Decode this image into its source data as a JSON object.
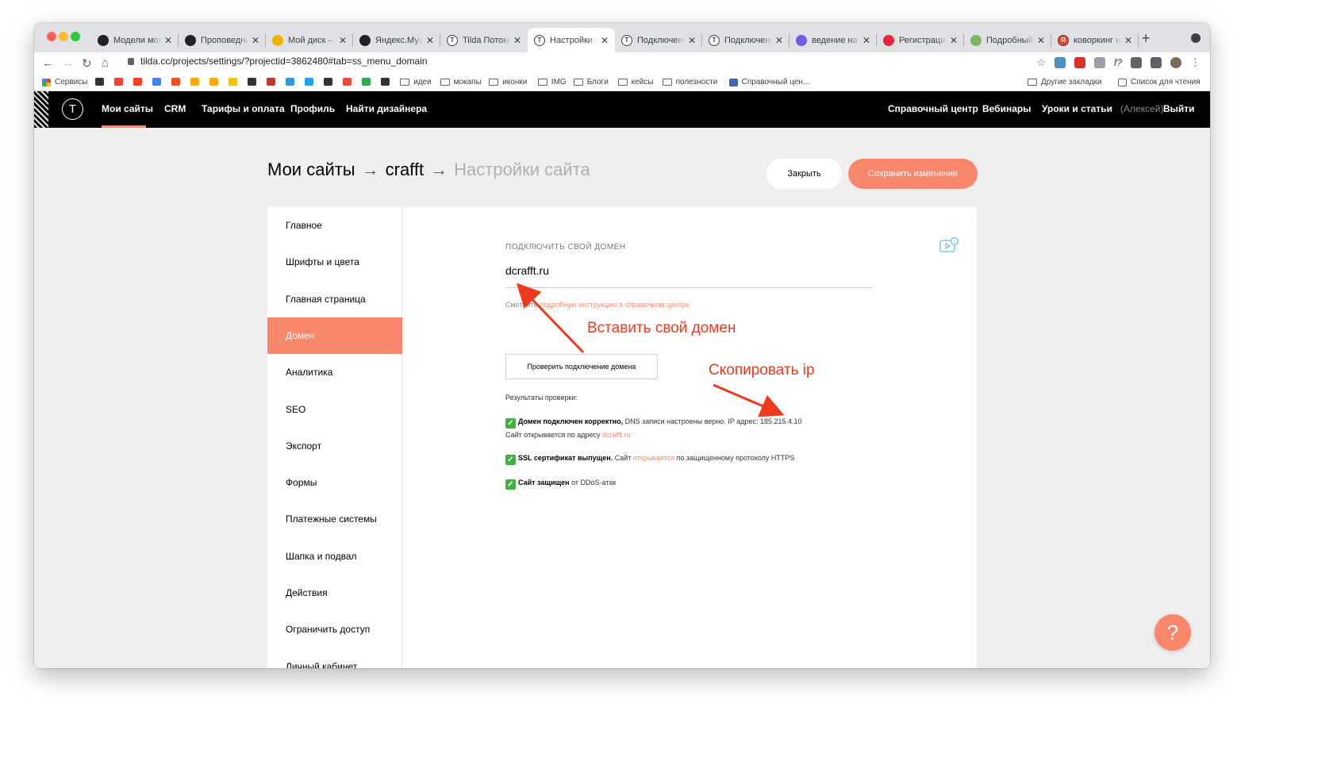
{
  "browser": {
    "tabs": [
      {
        "title": "Модели моне",
        "fav_color": "#222222",
        "fav_text": ""
      },
      {
        "title": "Проповедни",
        "fav_color": "#222222",
        "fav_text": ""
      },
      {
        "title": "Мой диск – G",
        "fav_color": "#f2b400",
        "fav_text": ""
      },
      {
        "title": "Яндекс.Музы",
        "fav_color": "#222222",
        "fav_text": ""
      },
      {
        "title": "Tilda Потоки",
        "fav_color": "#ffffff",
        "fav_text": "T"
      },
      {
        "title": "Настройки с",
        "fav_color": "#ffffff",
        "fav_text": "T"
      },
      {
        "title": "Подключени",
        "fav_color": "#ffffff",
        "fav_text": "T"
      },
      {
        "title": "Подключени",
        "fav_color": "#ffffff",
        "fav_text": "T"
      },
      {
        "title": "ведение на д",
        "fav_color": "#6d5ce8",
        "fav_text": ""
      },
      {
        "title": "Регистрация",
        "fav_color": "#e8233a",
        "fav_text": ""
      },
      {
        "title": "Подробный",
        "fav_color": "#7bb661",
        "fav_text": ""
      },
      {
        "title": "коворкинг на",
        "fav_color": "#fc3f1d",
        "fav_text": "Я"
      }
    ],
    "active_tab": 5,
    "url": "tilda.cc/projects/settings/?projectid=3862480#tab=ss_menu_domain",
    "bookmarks": [
      {
        "label": "Сервисы",
        "kind": "apps"
      },
      {
        "label": "",
        "kind": "icon",
        "color": "#333333"
      },
      {
        "label": "",
        "kind": "icon",
        "color": "#ea4335"
      },
      {
        "label": "",
        "kind": "icon",
        "color": "#fc3f1d"
      },
      {
        "label": "",
        "kind": "icon",
        "color": "#4285f4"
      },
      {
        "label": "",
        "kind": "icon",
        "color": "#f24e1e"
      },
      {
        "label": "",
        "kind": "icon",
        "color": "#f9ab00"
      },
      {
        "label": "",
        "kind": "icon",
        "color": "#f9ab00"
      },
      {
        "label": "",
        "kind": "icon",
        "color": "#f2c200"
      },
      {
        "label": "",
        "kind": "icon",
        "color": "#333333"
      },
      {
        "label": "",
        "kind": "icon",
        "color": "#c0392b"
      },
      {
        "label": "",
        "kind": "icon",
        "color": "#2d9cdb"
      },
      {
        "label": "",
        "kind": "icon",
        "color": "#1da1f2"
      },
      {
        "label": "",
        "kind": "icon",
        "color": "#333333"
      },
      {
        "label": "",
        "kind": "icon",
        "color": "#e74c3c"
      },
      {
        "label": "",
        "kind": "icon",
        "color": "#34a853"
      },
      {
        "label": "",
        "kind": "icon",
        "color": "#333333"
      },
      {
        "label": "идеи",
        "kind": "folder"
      },
      {
        "label": "мокапы",
        "kind": "folder"
      },
      {
        "label": "иконки",
        "kind": "folder"
      },
      {
        "label": "IMG",
        "kind": "folder"
      },
      {
        "label": "Блоги",
        "kind": "folder"
      },
      {
        "label": "кейсы",
        "kind": "folder"
      },
      {
        "label": "полезности",
        "kind": "folder"
      },
      {
        "label": "Справочный цен...",
        "kind": "fb"
      }
    ],
    "other_bookmarks": "Другие закладки",
    "reading_list": "Список для чтения"
  },
  "header": {
    "nav": [
      "Мои сайты",
      "CRM",
      "Тарифы и оплата",
      "Профиль",
      "Найти дизайнера"
    ],
    "right": [
      "Справочный центр",
      "Вебинары",
      "Уроки и статьи"
    ],
    "user": "(Алексей)",
    "logout": "Выйти"
  },
  "page": {
    "crumb_1": "Мои сайты",
    "arrow": "→",
    "crumb_2": "crafft",
    "crumb_3": "Настройки сайта",
    "close_label": "Закрыть",
    "save_label": "Сохранить изменения"
  },
  "sidebar": {
    "items": [
      "Главное",
      "Шрифты и цвета",
      "Главная страница",
      "Домен",
      "Аналитика",
      "SEO",
      "Экспорт",
      "Формы",
      "Платежные системы",
      "Шапка и подвал",
      "Действия",
      "Ограничить доступ",
      "Личный кабинет"
    ],
    "active": 3
  },
  "domain": {
    "label": "Подключить свой домен",
    "value": "dcrafft.ru",
    "hint_prefix": "Смотрите",
    "hint_link": "подробную инструкцию в справочном центре",
    "check_button": "Проверить подключение домена",
    "results_title": "Результаты проверки:",
    "r1_bold": "Домен подключен корректно,",
    "r1_text": " DNS записи настроены верно. IP адрес: 185.215.4.10",
    "r1_line2": "Сайт открывается по адресу ",
    "r1_link": "dcrafft.ru",
    "r2_bold": "SSL сертификат выпущен.",
    "r2_text1": " Сайт ",
    "r2_link": "открывается",
    "r2_text2": " по защищенному протоколу HTTPS",
    "r3_bold": "Сайт защищен",
    "r3_text": " от DDoS-атак"
  },
  "annotations": {
    "paste": "Вставить свой домен",
    "copy": "Скопировать ip"
  },
  "help": "?",
  "colors": {
    "accent": "#fa876b",
    "annot": "#ee3a1e",
    "ok": "#3eb43e"
  }
}
